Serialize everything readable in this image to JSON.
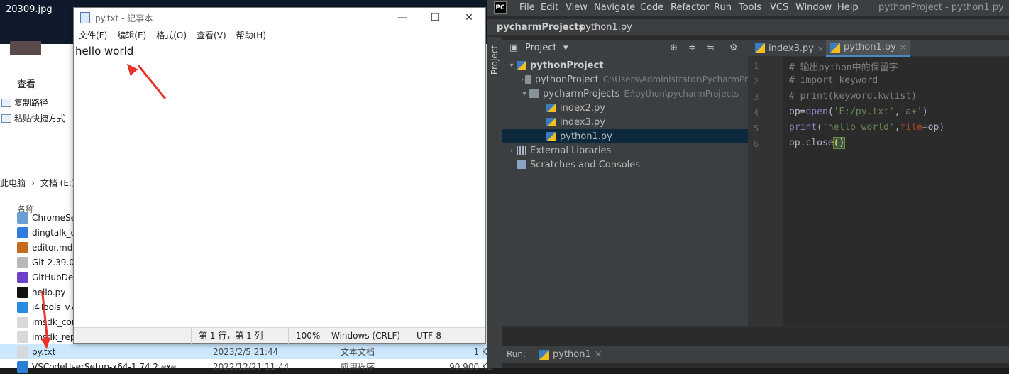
{
  "desktop": {
    "title": "20309.jpg"
  },
  "explorer": {
    "view_tab": "查看",
    "cmd_copy_path": "复制路径",
    "cmd_paste_shortcut": "粘贴快捷方式",
    "breadcrumb": [
      "此电脑",
      "文档 (E:)"
    ],
    "col_name": "名称",
    "files": [
      {
        "name": "ChromeSe",
        "date": "",
        "type": "",
        "size": "",
        "color": "#6a9fd4"
      },
      {
        "name": "dingtalk_d",
        "date": "",
        "type": "",
        "size": "",
        "color": "#2f7de1"
      },
      {
        "name": "editor.md",
        "date": "",
        "type": "",
        "size": "",
        "color": "#c46a1c"
      },
      {
        "name": "Git-2.39.0-",
        "date": "",
        "type": "",
        "size": "",
        "color": "#b8b8b8"
      },
      {
        "name": "GitHubDe",
        "date": "",
        "type": "",
        "size": "",
        "color": "#6e40c9"
      },
      {
        "name": "hello.py",
        "date": "",
        "type": "",
        "size": "",
        "color": "#111111"
      },
      {
        "name": "i4Tools_v7",
        "date": "",
        "type": "",
        "size": "",
        "color": "#2b8be0"
      },
      {
        "name": "imsdk_cor",
        "date": "",
        "type": "",
        "size": "",
        "color": "#d8d8d8"
      },
      {
        "name": "imsdk_rep",
        "date": "",
        "type": "",
        "size": "",
        "color": "#d8d8d8"
      },
      {
        "name": "py.txt",
        "date": "2023/2/5 21:44",
        "type": "文本文档",
        "size": "1 KB",
        "color": "#d8d8d8"
      },
      {
        "name": "VSCodeUserSetup-x64-1.74.2.exe",
        "date": "2022/12/21 11:44",
        "type": "应用程序",
        "size": "90,900 KB",
        "color": "#2b7fd4"
      }
    ]
  },
  "notepad": {
    "title": "py.txt - 记事本",
    "menus": [
      "文件(F)",
      "编辑(E)",
      "格式(O)",
      "查看(V)",
      "帮助(H)"
    ],
    "content": "hello world",
    "status": {
      "position": "第 1 行，第 1 列",
      "zoom": "100%",
      "eol": "Windows (CRLF)",
      "encoding": "UTF-8"
    },
    "win_min": "—",
    "win_max": "☐",
    "win_close": "✕"
  },
  "pycharm": {
    "logo": "PC",
    "menus": [
      "File",
      "Edit",
      "View",
      "Navigate",
      "Code",
      "Refactor",
      "Run",
      "Tools",
      "VCS",
      "Window",
      "Help"
    ],
    "window_title": "pythonProject - python1.py",
    "breadcrumb": [
      "pycharmProjects",
      "python1.py"
    ],
    "side_tab": "Project",
    "project_title": "Project",
    "tree": [
      {
        "label": "pythonProject",
        "path": "",
        "bold": true,
        "twisty": "v",
        "kind": "pyf"
      },
      {
        "label": "pythonProject",
        "path": "C:\\Users\\Administrator\\PycharmPr",
        "bold": false,
        "twisty": ">",
        "kind": "fold"
      },
      {
        "label": "pycharmProjects",
        "path": "E:\\python\\pycharmProjects",
        "bold": false,
        "twisty": "v",
        "kind": "fold"
      },
      {
        "label": "index2.py",
        "path": "",
        "bold": false,
        "twisty": "",
        "kind": "pyf"
      },
      {
        "label": "index3.py",
        "path": "",
        "bold": false,
        "twisty": "",
        "kind": "pyf"
      },
      {
        "label": "python1.py",
        "path": "",
        "bold": false,
        "twisty": "",
        "kind": "pyf"
      },
      {
        "label": "External Libraries",
        "path": "",
        "bold": false,
        "twisty": ">",
        "kind": "libf"
      },
      {
        "label": "Scratches and Consoles",
        "path": "",
        "bold": false,
        "twisty": "",
        "kind": "scrf"
      }
    ],
    "tabs": [
      {
        "label": "index3.py",
        "active": false
      },
      {
        "label": "python1.py",
        "active": true
      }
    ],
    "code_lines": [
      "1",
      "2",
      "3",
      "4",
      "5",
      "6"
    ],
    "code": {
      "l1": "# 输出python中的保留字",
      "l2": "# import keyword",
      "l3": "# print(keyword.kwlist)",
      "l4_a": "op=",
      "l4_b": "open",
      "l4_c": "(",
      "l4_d": "'E:/py.txt'",
      "l4_e": ",",
      "l4_f": "'a+'",
      "l4_g": ")",
      "l5_a": "print",
      "l5_b": "(",
      "l5_c": "'hello world'",
      "l5_d": ",",
      "l5_e": "file",
      "l5_f": "=op)",
      "l6_a": "op.close",
      "l6_b": "()"
    },
    "run_label": "Run:",
    "run_tab": "python1",
    "tab_close": "×"
  }
}
